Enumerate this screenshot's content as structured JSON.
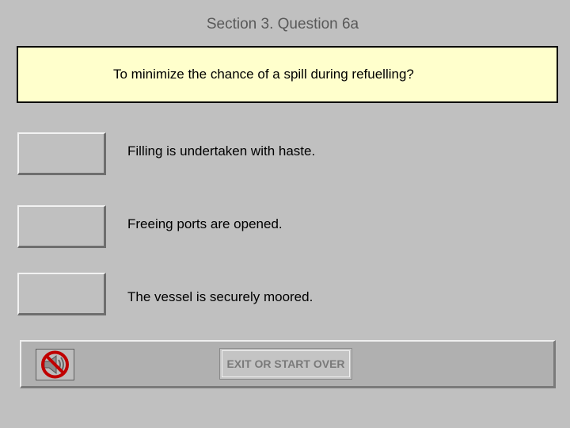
{
  "header": {
    "title": "Section 3. Question 6a"
  },
  "question": {
    "text": "To minimize the chance of a spill during refuelling?"
  },
  "answers": [
    {
      "label": "Filling is undertaken with haste."
    },
    {
      "label": "Freeing ports are opened."
    },
    {
      "label": "The vessel is securely moored."
    }
  ],
  "navigation": {
    "audio_icon": "speaker-muted-icon",
    "exit_label": "EXIT OR START OVER"
  },
  "colors": {
    "background": "#c0c0c0",
    "question_box": "#ffffcc",
    "prohibition_red": "#c00000"
  }
}
